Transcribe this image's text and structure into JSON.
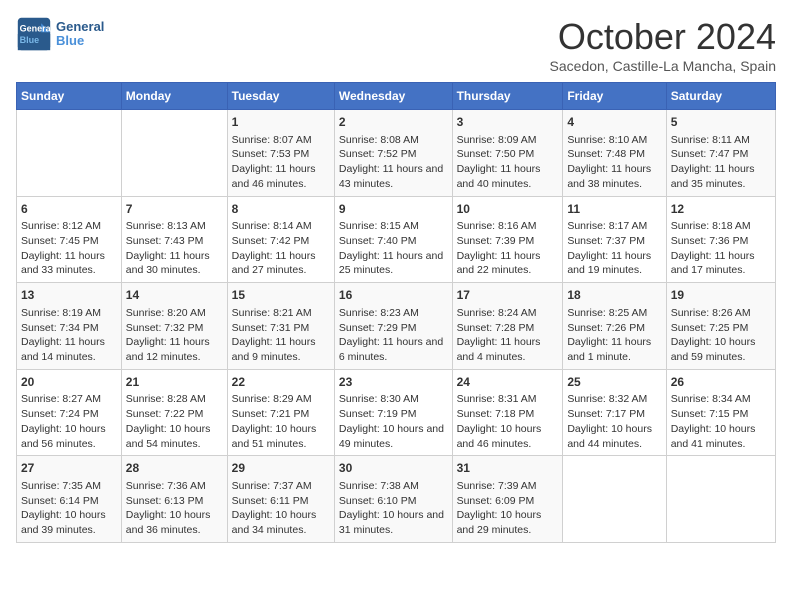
{
  "logo": {
    "line1": "General",
    "line2": "Blue"
  },
  "title": "October 2024",
  "subtitle": "Sacedon, Castille-La Mancha, Spain",
  "days_of_week": [
    "Sunday",
    "Monday",
    "Tuesday",
    "Wednesday",
    "Thursday",
    "Friday",
    "Saturday"
  ],
  "weeks": [
    [
      {
        "day": "",
        "sunrise": "",
        "sunset": "",
        "daylight": ""
      },
      {
        "day": "",
        "sunrise": "",
        "sunset": "",
        "daylight": ""
      },
      {
        "day": "1",
        "sunrise": "Sunrise: 8:07 AM",
        "sunset": "Sunset: 7:53 PM",
        "daylight": "Daylight: 11 hours and 46 minutes."
      },
      {
        "day": "2",
        "sunrise": "Sunrise: 8:08 AM",
        "sunset": "Sunset: 7:52 PM",
        "daylight": "Daylight: 11 hours and 43 minutes."
      },
      {
        "day": "3",
        "sunrise": "Sunrise: 8:09 AM",
        "sunset": "Sunset: 7:50 PM",
        "daylight": "Daylight: 11 hours and 40 minutes."
      },
      {
        "day": "4",
        "sunrise": "Sunrise: 8:10 AM",
        "sunset": "Sunset: 7:48 PM",
        "daylight": "Daylight: 11 hours and 38 minutes."
      },
      {
        "day": "5",
        "sunrise": "Sunrise: 8:11 AM",
        "sunset": "Sunset: 7:47 PM",
        "daylight": "Daylight: 11 hours and 35 minutes."
      }
    ],
    [
      {
        "day": "6",
        "sunrise": "Sunrise: 8:12 AM",
        "sunset": "Sunset: 7:45 PM",
        "daylight": "Daylight: 11 hours and 33 minutes."
      },
      {
        "day": "7",
        "sunrise": "Sunrise: 8:13 AM",
        "sunset": "Sunset: 7:43 PM",
        "daylight": "Daylight: 11 hours and 30 minutes."
      },
      {
        "day": "8",
        "sunrise": "Sunrise: 8:14 AM",
        "sunset": "Sunset: 7:42 PM",
        "daylight": "Daylight: 11 hours and 27 minutes."
      },
      {
        "day": "9",
        "sunrise": "Sunrise: 8:15 AM",
        "sunset": "Sunset: 7:40 PM",
        "daylight": "Daylight: 11 hours and 25 minutes."
      },
      {
        "day": "10",
        "sunrise": "Sunrise: 8:16 AM",
        "sunset": "Sunset: 7:39 PM",
        "daylight": "Daylight: 11 hours and 22 minutes."
      },
      {
        "day": "11",
        "sunrise": "Sunrise: 8:17 AM",
        "sunset": "Sunset: 7:37 PM",
        "daylight": "Daylight: 11 hours and 19 minutes."
      },
      {
        "day": "12",
        "sunrise": "Sunrise: 8:18 AM",
        "sunset": "Sunset: 7:36 PM",
        "daylight": "Daylight: 11 hours and 17 minutes."
      }
    ],
    [
      {
        "day": "13",
        "sunrise": "Sunrise: 8:19 AM",
        "sunset": "Sunset: 7:34 PM",
        "daylight": "Daylight: 11 hours and 14 minutes."
      },
      {
        "day": "14",
        "sunrise": "Sunrise: 8:20 AM",
        "sunset": "Sunset: 7:32 PM",
        "daylight": "Daylight: 11 hours and 12 minutes."
      },
      {
        "day": "15",
        "sunrise": "Sunrise: 8:21 AM",
        "sunset": "Sunset: 7:31 PM",
        "daylight": "Daylight: 11 hours and 9 minutes."
      },
      {
        "day": "16",
        "sunrise": "Sunrise: 8:23 AM",
        "sunset": "Sunset: 7:29 PM",
        "daylight": "Daylight: 11 hours and 6 minutes."
      },
      {
        "day": "17",
        "sunrise": "Sunrise: 8:24 AM",
        "sunset": "Sunset: 7:28 PM",
        "daylight": "Daylight: 11 hours and 4 minutes."
      },
      {
        "day": "18",
        "sunrise": "Sunrise: 8:25 AM",
        "sunset": "Sunset: 7:26 PM",
        "daylight": "Daylight: 11 hours and 1 minute."
      },
      {
        "day": "19",
        "sunrise": "Sunrise: 8:26 AM",
        "sunset": "Sunset: 7:25 PM",
        "daylight": "Daylight: 10 hours and 59 minutes."
      }
    ],
    [
      {
        "day": "20",
        "sunrise": "Sunrise: 8:27 AM",
        "sunset": "Sunset: 7:24 PM",
        "daylight": "Daylight: 10 hours and 56 minutes."
      },
      {
        "day": "21",
        "sunrise": "Sunrise: 8:28 AM",
        "sunset": "Sunset: 7:22 PM",
        "daylight": "Daylight: 10 hours and 54 minutes."
      },
      {
        "day": "22",
        "sunrise": "Sunrise: 8:29 AM",
        "sunset": "Sunset: 7:21 PM",
        "daylight": "Daylight: 10 hours and 51 minutes."
      },
      {
        "day": "23",
        "sunrise": "Sunrise: 8:30 AM",
        "sunset": "Sunset: 7:19 PM",
        "daylight": "Daylight: 10 hours and 49 minutes."
      },
      {
        "day": "24",
        "sunrise": "Sunrise: 8:31 AM",
        "sunset": "Sunset: 7:18 PM",
        "daylight": "Daylight: 10 hours and 46 minutes."
      },
      {
        "day": "25",
        "sunrise": "Sunrise: 8:32 AM",
        "sunset": "Sunset: 7:17 PM",
        "daylight": "Daylight: 10 hours and 44 minutes."
      },
      {
        "day": "26",
        "sunrise": "Sunrise: 8:34 AM",
        "sunset": "Sunset: 7:15 PM",
        "daylight": "Daylight: 10 hours and 41 minutes."
      }
    ],
    [
      {
        "day": "27",
        "sunrise": "Sunrise: 7:35 AM",
        "sunset": "Sunset: 6:14 PM",
        "daylight": "Daylight: 10 hours and 39 minutes."
      },
      {
        "day": "28",
        "sunrise": "Sunrise: 7:36 AM",
        "sunset": "Sunset: 6:13 PM",
        "daylight": "Daylight: 10 hours and 36 minutes."
      },
      {
        "day": "29",
        "sunrise": "Sunrise: 7:37 AM",
        "sunset": "Sunset: 6:11 PM",
        "daylight": "Daylight: 10 hours and 34 minutes."
      },
      {
        "day": "30",
        "sunrise": "Sunrise: 7:38 AM",
        "sunset": "Sunset: 6:10 PM",
        "daylight": "Daylight: 10 hours and 31 minutes."
      },
      {
        "day": "31",
        "sunrise": "Sunrise: 7:39 AM",
        "sunset": "Sunset: 6:09 PM",
        "daylight": "Daylight: 10 hours and 29 minutes."
      },
      {
        "day": "",
        "sunrise": "",
        "sunset": "",
        "daylight": ""
      },
      {
        "day": "",
        "sunrise": "",
        "sunset": "",
        "daylight": ""
      }
    ]
  ]
}
